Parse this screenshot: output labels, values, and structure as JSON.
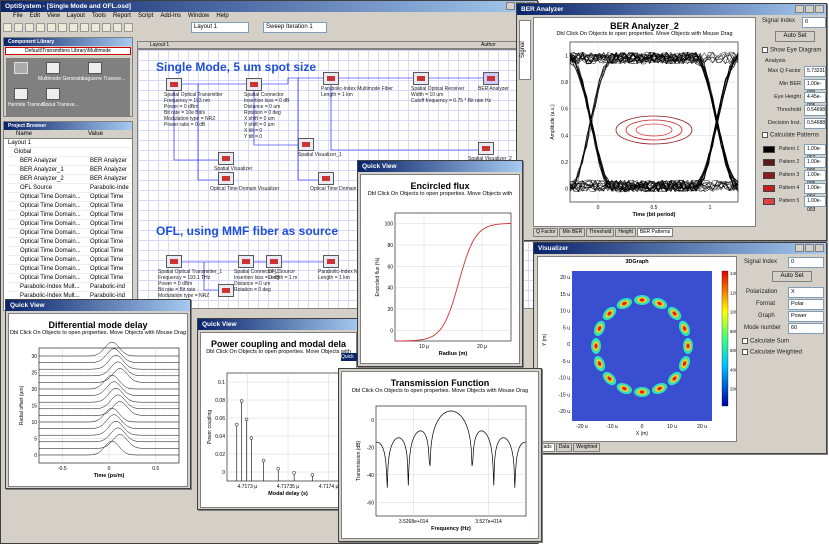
{
  "main": {
    "title": "OptiSystem - [Single Mode and OFL.osd]",
    "menu": [
      "File",
      "Edit",
      "View",
      "Layout",
      "Tools",
      "Report",
      "Script",
      "Add-Ins",
      "Window",
      "Help"
    ],
    "layout_select": "Layout 1",
    "sweep_select": "Sweep Iteration 1",
    "layout_header": "Layout 1",
    "author_header": "Author"
  },
  "library": {
    "title": "Component Library",
    "path": "Default\\Transmitters Library\\Multimode",
    "items": [
      "Multimode Generator",
      "Laguerre Transve...",
      "Hermite Transve...",
      "Donut Transve..."
    ]
  },
  "browser": {
    "title": "Project Browser",
    "cols": [
      "Name",
      "Value"
    ],
    "rows": [
      [
        "Layout 1",
        ""
      ],
      [
        "Global",
        ""
      ],
      [
        "BER Analyzer",
        "BER Analyzer"
      ],
      [
        "BER Analyzer_1",
        "BER Analyzer"
      ],
      [
        "BER Analyzer_2",
        "BER Analyzer"
      ],
      [
        "OFL Source",
        "Parabolic-Inde"
      ],
      [
        "Optical Time Domain...",
        "Optical Time"
      ],
      [
        "Optical Time Domain...",
        "Optical Time"
      ],
      [
        "Optical Time Domain...",
        "Optical Time"
      ],
      [
        "Optical Time Domain...",
        "Optical Time"
      ],
      [
        "Optical Time Domain...",
        "Optical Time"
      ],
      [
        "Optical Time Domain...",
        "Optical Time"
      ],
      [
        "Optical Time Domain...",
        "Optical Time"
      ],
      [
        "Optical Time Domain...",
        "Optical Time"
      ],
      [
        "Optical Time Domain...",
        "Optical Time"
      ],
      [
        "Optical Time Domain...",
        "Optical Time"
      ],
      [
        "Parabolic-Index Mult...",
        "Parabolic-ind"
      ],
      [
        "Parabolic-Index Mult...",
        "Parabolic-ind"
      ]
    ]
  },
  "canvas": {
    "heading1": "Single Mode, 5 um spot size",
    "heading2": "OFL, using MMF fiber as source",
    "labels": {
      "tx1": "Spatial Optical Transmitter\nFrequency = 193 nm\nPower = 0 dBm\nBit rate = 10e Bit/s\nModulation type = NRZ\nPower ratio = 0 dB",
      "conn1": "Spatial Connector\nInsertion loss = 0 dB\nDistance = 0 um\nRotation = 0 deg\nX shift = 0 um\nY shift = 0 um\nX tilt = 0\nY tilt = 0",
      "fiber1": "Parabolic-Index Multimode Fiber\nLength = 1 km",
      "rx1": "Spatial Optical Receiver\nWidth = 10 um\nCutoff frequency = 0.75 * Bit rate Hz",
      "ber1": "BER Analyzer",
      "sv1": "Spatial Visualizer",
      "sv2": "Spatial Visualizer_1",
      "sv3": "Spatial Visualizer_2",
      "otdv1": "Optical Time Domain Visualizer",
      "otdv2": "Optical Time Domain Visualizer",
      "tx2": "Spatial Optical Transmitter_1\nFrequency = 193.1 THz\nPower = 0 dBm\nBit rate = Bit rate\nModulation type = NRZ",
      "conn2": "Spatial Connector_1\nInsertion loss = 0 dB\nDistance = 0 um\nRotation = 0 deg",
      "ofl": "OFL Source\nLength = 1 m",
      "fiber2": "Parabolic-Index Mult\nLength = 1 km"
    }
  },
  "ber": {
    "title": "BER Analyzer",
    "tab": "Signal",
    "plot_title": "BER Analyzer_2",
    "sub": "Dbl Click On Objects to open properties.  Move Objects with Mouse Drag",
    "xlabel": "Time (bit period)",
    "ylabel": "Amplitude (a.u.)",
    "xticks": [
      "0",
      "0.5",
      "1"
    ],
    "yticks": [
      "0",
      "0.2",
      "0.4",
      "0.6",
      "0.8",
      "1"
    ],
    "signal_index_label": "Signal Index",
    "signal_index": "0",
    "autoset": "Auto Set",
    "show_eye": "Show Eye Diagram",
    "analysis": "Analysis",
    "fields": [
      [
        "Max Q Factor",
        "5.73231"
      ],
      [
        "Min BER",
        "1.00e-009"
      ],
      [
        "Eye Height",
        "4.45e-005"
      ],
      [
        "Threshold",
        "0.54698"
      ],
      [
        "Decision Inst.",
        "0.54688"
      ]
    ],
    "calc_patterns": "Calculate Patterns",
    "patterns": [
      [
        "Pattern 1",
        "1.00e-007",
        "#000000"
      ],
      [
        "Pattern 2",
        "1.00e-006",
        "#5a1a1a"
      ],
      [
        "Pattern 3",
        "1.00e-005",
        "#8b1a1a"
      ],
      [
        "Pattern 4",
        "1.00e-004",
        "#c02020"
      ],
      [
        "Pattern 5",
        "1.00e-003",
        "#e04040"
      ]
    ],
    "tabs": [
      "Q Factor",
      "Min BER",
      "Threshold",
      "Height",
      "BER Patterns"
    ]
  },
  "vis": {
    "title": "Visualizer",
    "plot_title": "3DGraph",
    "signal_index_label": "Signal Index",
    "signal_index": "0",
    "autoset": "Auto Set",
    "pol_label": "Polarization",
    "pol": "X",
    "format_label": "Format",
    "format": "Polar",
    "graph_label": "Graph",
    "graph": "Power",
    "mode_label": "Mode number",
    "mode": "60",
    "calc_sum": "Calculate Sum",
    "calc_weighted": "Calculate Weighted",
    "yticks": [
      "20 u",
      "15 u",
      "10 u",
      "5 u",
      "0",
      "-5 u",
      "-10 u",
      "-15 u",
      "-20 u"
    ],
    "xticks": [
      "-20 u",
      "-10 u",
      "0",
      "10 u",
      "20 u"
    ],
    "xlabel": "X (m)",
    "ylabel": "Y (m)",
    "zlabel": "Power (W/m²) - Intensity",
    "cticks": [
      "1400 m",
      "1200 m",
      "1000 m",
      "800 m",
      "600 m",
      "400 m",
      "200 m"
    ],
    "tabs": [
      "Rads",
      "Data",
      "Weighted"
    ]
  },
  "qv_encircled": {
    "bar": "Quick View",
    "title": "Encircled flux",
    "sub": "Dbl Click On Objects to open properties.  Move Objects with",
    "xlabel": "Radius (m)",
    "ylabel": "Encircled flux (%)",
    "xticks": [
      "10 µ",
      "20 µ"
    ],
    "yticks": [
      "100",
      "80",
      "60",
      "40",
      "20",
      "0"
    ]
  },
  "qv_dmd": {
    "bar": "Quick View",
    "title": "Differential mode delay",
    "sub": "Dbl Click On Objects to open properties.  Move Objects with Mouse Drag",
    "xlabel": "Time (ps/m)",
    "ylabel": "Radial offset (µm)",
    "xticks": [
      "-0.5",
      "0",
      "0.5"
    ],
    "yticks": [
      "30",
      "25",
      "20",
      "15",
      "10",
      "5",
      "0"
    ]
  },
  "qv_power": {
    "bar": "Quick View",
    "title": "Power coupling and modal dela",
    "sub": "Dbl Click On Objects to open properties.  Move Objects with",
    "xlabel": "Modal delay (s)",
    "ylabel": "Power coupling",
    "xticks": [
      "4.7173 µ",
      "4.71735 µ",
      "4.7174 µ"
    ],
    "yticks": [
      "0.1",
      "0.08",
      "0.06",
      "0.04",
      "0.02",
      "0"
    ],
    "tab": "Quick"
  },
  "qv_tf": {
    "title": "Transmission Function",
    "sub": "Dbl Click On Objects to open properties.  Move Objects with Mouse Drag",
    "xlabel": "Frequency (Hz)",
    "ylabel": "Transmission (dB)",
    "xticks": [
      "3.5268e+014",
      "3.527e+014"
    ],
    "yticks": [
      "0",
      "-20",
      "-40",
      "-60"
    ]
  }
}
